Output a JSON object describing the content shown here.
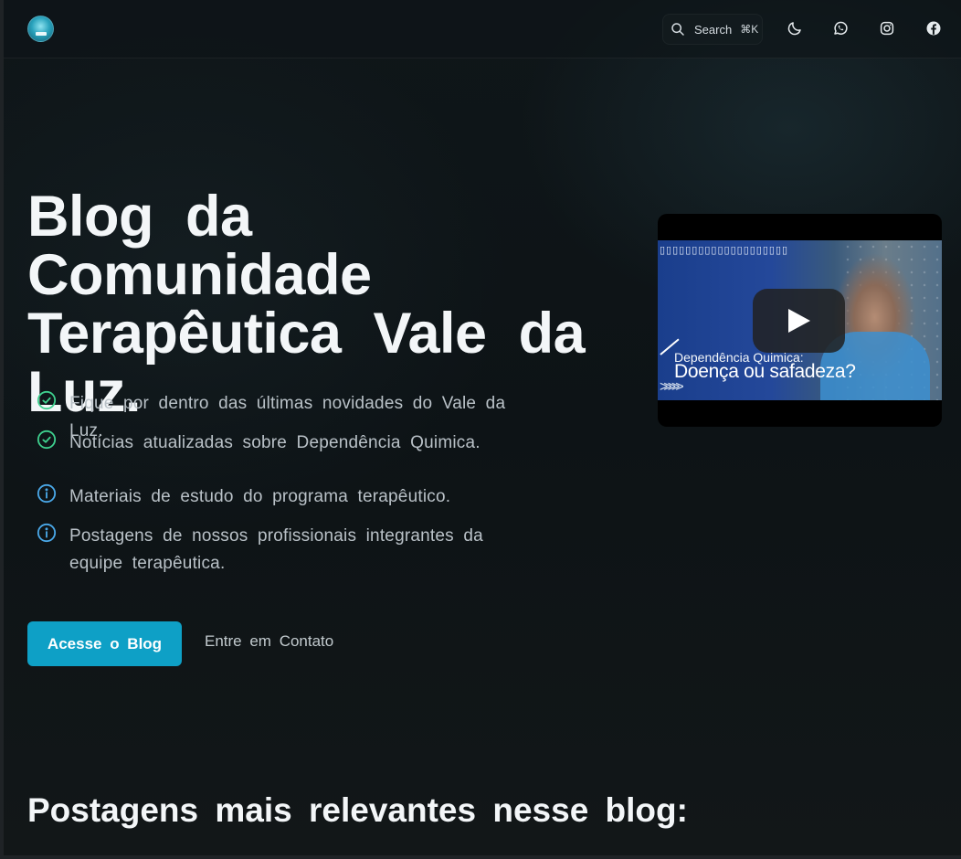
{
  "header": {
    "search_label": "Search",
    "search_shortcut": "⌘K",
    "icons": [
      "moon-icon",
      "whatsapp-icon",
      "instagram-icon",
      "facebook-icon"
    ]
  },
  "hero": {
    "title_line1": "Blog da Comunidade",
    "title_line2": "Terapêutica Vale da",
    "title_line3": "Luz.",
    "features": [
      {
        "icon": "check-circle-icon",
        "text": "Fique por dentro das últimas novidades do Vale da Luz."
      },
      {
        "icon": "check-circle-icon",
        "text": "Notícias atualizadas sobre Dependência Quimica."
      },
      {
        "icon": "info-circle-icon",
        "text": "Materiais de estudo do programa terapêutico."
      },
      {
        "icon": "info-circle-icon",
        "text": "Postagens de nossos profissionais integrantes da equipe terapêutica."
      }
    ],
    "primary_button": "Acesse o Blog",
    "secondary_link": "Entre em Contato"
  },
  "video": {
    "channel_text": "▯▯▯▯▯▯▯▯▯▯▯▯▯▯▯▯▯▯▯▯",
    "caption_small": "Dependência Quimica:",
    "caption_large": "Doença ou safadeza?"
  },
  "section": {
    "title": "Postagens mais relevantes nesse blog:"
  },
  "colors": {
    "accent": "#0ea0c6",
    "check_icon": "#3ecf8e",
    "info_icon": "#4aa8e8",
    "background": "#0f1619"
  }
}
